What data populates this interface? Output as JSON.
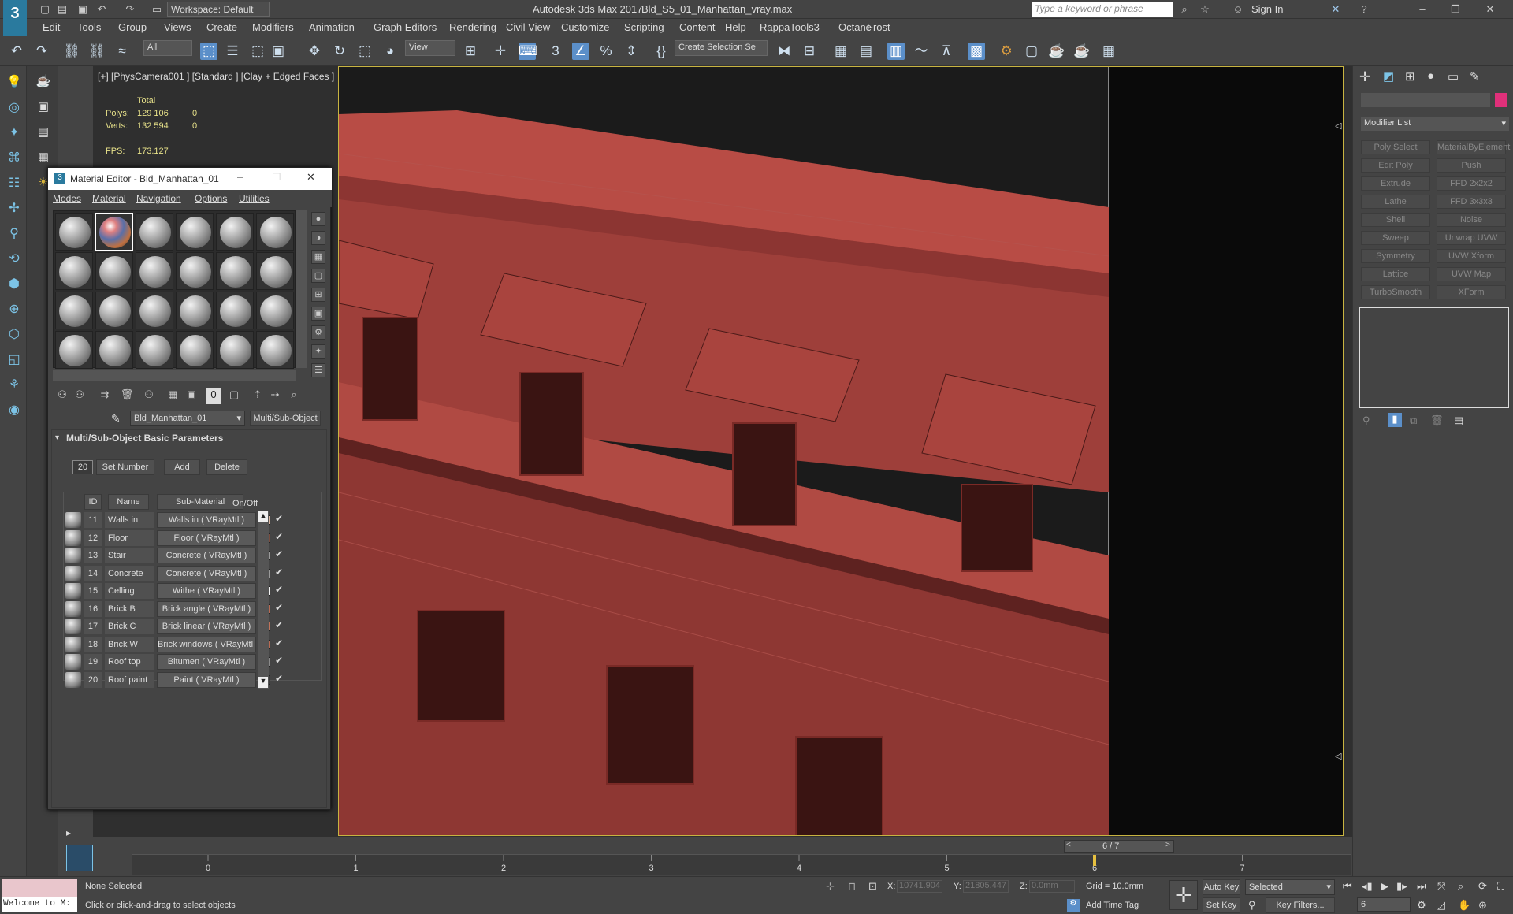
{
  "app": {
    "title": "Autodesk 3ds Max 2017",
    "file": "Bld_S5_01_Manhattan_vray.max",
    "workspace": "Workspace: Default",
    "search_placeholder": "Type a keyword or phrase",
    "sign_in": "Sign In"
  },
  "menu": [
    "Edit",
    "Tools",
    "Group",
    "Views",
    "Create",
    "Modifiers",
    "Animation",
    "Graph Editors",
    "Rendering",
    "Civil View",
    "Customize",
    "Scripting",
    "Content",
    "Help",
    "RappaTools3",
    "Octane",
    "Frost"
  ],
  "toolbar": {
    "filter": "All",
    "view": "View",
    "selection_set": "Create Selection Se"
  },
  "viewport": {
    "label": "[+] [PhysCamera001 ] [Standard ] [Clay + Edged Faces ]",
    "stats": {
      "total_label": "Total",
      "polys_label": "Polys:",
      "polys_total": "129 106",
      "polys_sel": "0",
      "verts_label": "Verts:",
      "verts_total": "132 594",
      "verts_sel": "0",
      "fps_label": "FPS:",
      "fps": "173.127"
    }
  },
  "material_editor": {
    "title": "Material Editor - Bld_Manhattan_01",
    "menu": [
      "Modes",
      "Material",
      "Navigation",
      "Options",
      "Utilities"
    ],
    "material_name": "Bld_Manhattan_01",
    "material_type": "Multi/Sub-Object",
    "rollout_title": "Multi/Sub-Object Basic Parameters",
    "set_number_value": "20",
    "set_number_label": "Set Number",
    "add_label": "Add",
    "delete_label": "Delete",
    "col_id": "ID",
    "col_name": "Name",
    "col_submaterial": "Sub-Material",
    "col_onoff": "On/Off",
    "rows": [
      {
        "id": "11",
        "name": "Walls in",
        "sub": "Walls in  ( VRayMtl )",
        "color": "#d9b6a0",
        "on": true
      },
      {
        "id": "12",
        "name": "Floor",
        "sub": "Floor  ( VRayMtl )",
        "color": "#7a4c3e",
        "on": true
      },
      {
        "id": "13",
        "name": "Stair",
        "sub": "Concrete  ( VRayMtl )",
        "color": "#9a9a9a",
        "on": true
      },
      {
        "id": "14",
        "name": "Concrete",
        "sub": "Concrete  ( VRayMtl )",
        "color": "#9a9a9a",
        "on": true
      },
      {
        "id": "15",
        "name": "Celling",
        "sub": "Withe  ( VRayMtl )",
        "color": "#f2f2f2",
        "on": true
      },
      {
        "id": "16",
        "name": "Brick B",
        "sub": "Brick angle  ( VRayMtl )",
        "color": "#b86a52",
        "on": true
      },
      {
        "id": "17",
        "name": "Brick C",
        "sub": "Brick linear  ( VRayMtl )",
        "color": "#c0735a",
        "on": true
      },
      {
        "id": "18",
        "name": "Brick W",
        "sub": "Brick windows  ( VRayMtl )",
        "color": "#b86a52",
        "on": true
      },
      {
        "id": "19",
        "name": "Roof top",
        "sub": "Bitumen  ( VRayMtl )",
        "color": "#8a8a8a",
        "on": true
      },
      {
        "id": "20",
        "name": "Roof paint",
        "sub": "Paint  ( VRayMtl )",
        "color": "#3a3a3a",
        "on": true
      }
    ]
  },
  "command_panel": {
    "modifier_list": "Modifier List",
    "buttons": [
      "Poly Select",
      "MaterialByElement",
      "Edit Poly",
      "Push",
      "Extrude",
      "FFD 2x2x2",
      "Lathe",
      "FFD 3x3x3",
      "Shell",
      "Noise",
      "Sweep",
      "Unwrap UVW",
      "Symmetry",
      "UVW Xform",
      "Lattice",
      "UVW Map",
      "TurboSmooth",
      "XForm"
    ],
    "accent": "#e0307a"
  },
  "timeline": {
    "frame": "6 / 7",
    "ticks": [
      "0",
      "1",
      "2",
      "3",
      "4",
      "5",
      "6",
      "7"
    ],
    "current": 6
  },
  "status": {
    "selection": "None Selected",
    "prompt": "Click or click-and-drag to select objects",
    "maxscript": "Welcome to M:",
    "x_label": "X:",
    "x": "10741.904",
    "y_label": "Y:",
    "y": "21805.447",
    "z_label": "Z:",
    "z": "0.0mm",
    "grid": "Grid = 10.0mm",
    "add_time_tag": "Add Time Tag",
    "auto_key": "Auto Key",
    "set_key": "Set Key",
    "selected": "Selected",
    "key_filters": "Key Filters...",
    "frame_field": "6"
  }
}
